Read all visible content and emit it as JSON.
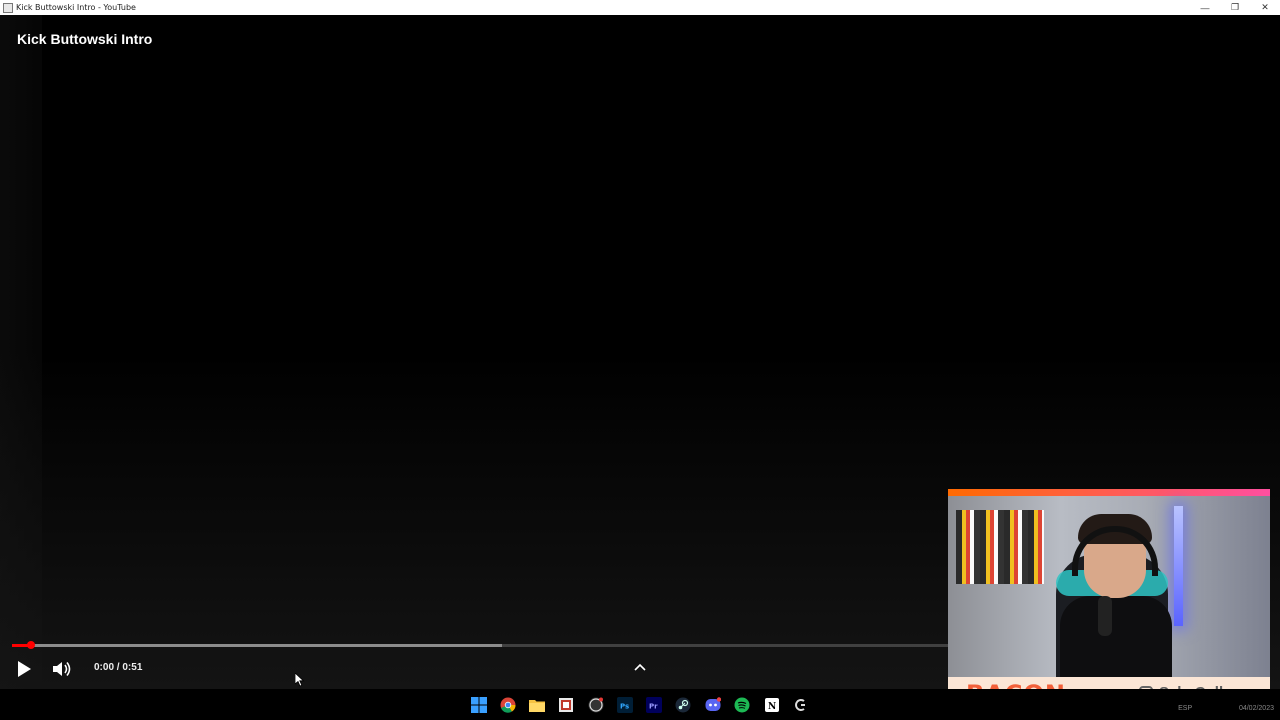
{
  "window": {
    "title": "Kick Buttowski Intro - YouTube",
    "controls": {
      "minimize": "—",
      "restore": "❐",
      "close": "✕"
    }
  },
  "player": {
    "video_title": "Kick Buttowski Intro",
    "progress": {
      "played_fraction": 0.015,
      "buffered_fraction": 0.39
    },
    "time": {
      "current": "0:00",
      "separator": " / ",
      "duration": "0:51"
    },
    "controls": {
      "play": "play-icon",
      "volume": "volume-icon",
      "expand": "chevron-up-icon"
    }
  },
  "webcam_overlay": {
    "banner_text": "BACON",
    "instagram_handle": "SebaCollares",
    "accent_colors": [
      "#ff6a00",
      "#ff4fa0"
    ]
  },
  "taskbar": {
    "icons": [
      "windows-start-icon",
      "chrome-icon",
      "file-explorer-icon",
      "snipping-tool-icon",
      "obs-icon",
      "photoshop-icon",
      "premiere-icon",
      "steam-icon",
      "discord-icon",
      "spotify-icon",
      "notion-icon",
      "logitech-icon"
    ],
    "tray": {
      "lang": "ESP",
      "date": "04/02/2023"
    }
  }
}
